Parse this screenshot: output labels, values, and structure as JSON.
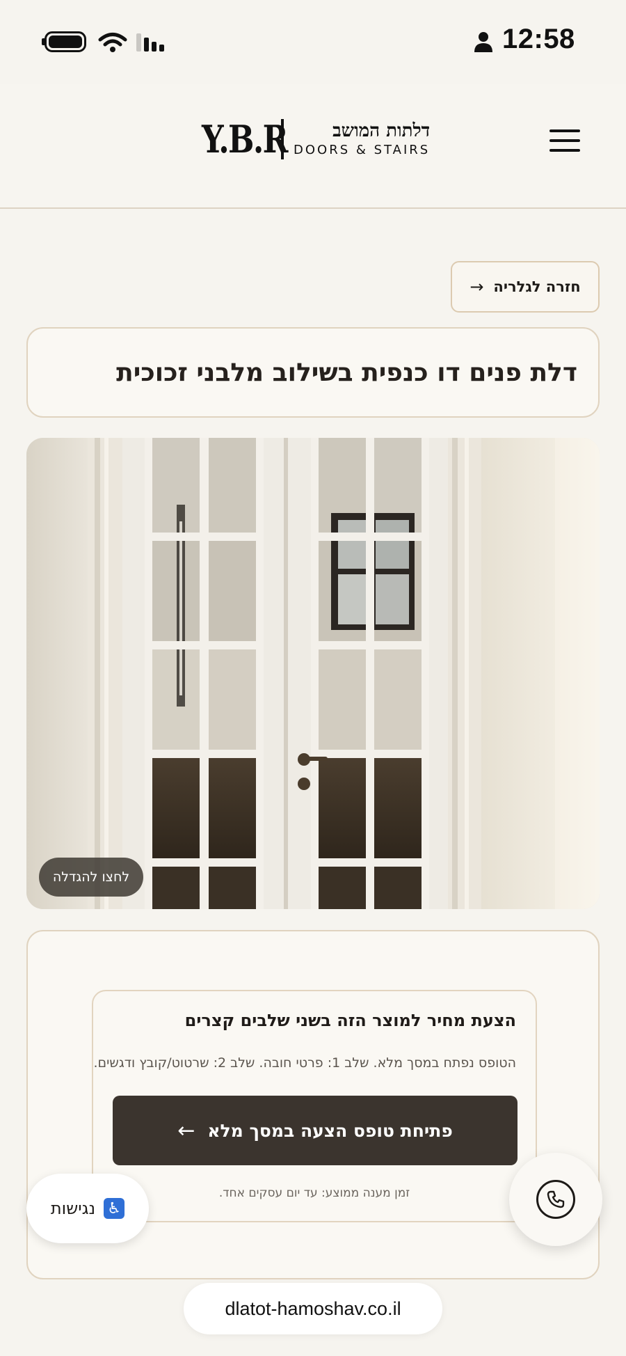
{
  "status_bar": {
    "time": "12:58"
  },
  "header": {
    "logo_mark": "Y.B.R",
    "logo_hebrew": "דלתות המושב",
    "logo_latin": "DOORS & STAIRS"
  },
  "back_button": {
    "label": "חזרה לגלריה",
    "arrow": "→"
  },
  "product": {
    "title": "דלת פנים דו כנפית בשילוב מלבני זכוכית",
    "zoom_hint": "לחצו להגדלה"
  },
  "quote": {
    "title": "הצעת מחיר למוצר הזה בשני שלבים קצרים",
    "description": "הטופס נפתח במסך מלא. שלב 1: פרטי חובה. שלב 2: שרטוט/קובץ ודגשים.",
    "cta_label": "פתיחת טופס הצעה במסך מלא",
    "cta_arrow": "←",
    "response_note": "זמן מענה ממוצע: עד יום עסקים אחד."
  },
  "accessibility": {
    "label": "נגישות",
    "icon_glyph": "♿"
  },
  "browser": {
    "url": "dlatot-hamoshav.co.il"
  },
  "colors": {
    "page_bg": "#f6f4ef",
    "card_border": "#e0d3bf",
    "cta_bg": "#3b342e",
    "accessibility_blue": "#2f6fd6"
  }
}
